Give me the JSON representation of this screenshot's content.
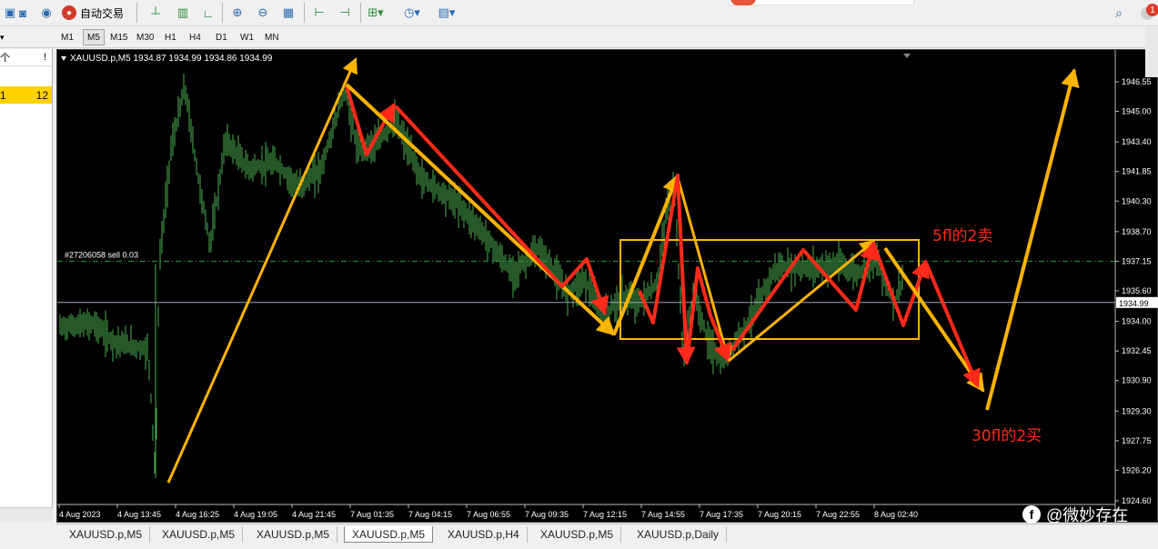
{
  "toolbar": {
    "auto_trade_label": "自动交易",
    "icons": [
      "account-icon",
      "signal-icon",
      "network-icon",
      "bar-chart-icon",
      "candle-chart-icon",
      "line-chart-icon",
      "zoom-in-icon",
      "zoom-out-icon",
      "tile-windows-icon",
      "auto-scroll-icon",
      "chart-shift-icon",
      "new-order-icon",
      "periods-icon",
      "templates-icon",
      "search-icon"
    ],
    "notification_count": "1"
  },
  "timeframes": [
    "M1",
    "M5",
    "M15",
    "M30",
    "H1",
    "H4",
    "D1",
    "W1",
    "MN"
  ],
  "active_timeframe": "M5",
  "left_panel": {
    "header_left": "个",
    "header_right": "!",
    "row_left": "1",
    "row_right": "12"
  },
  "chart": {
    "header": "XAUUSD.p,M5  1934.87 1934.99 1934.86 1934.99",
    "order_label": "#27206058 sell 0.03",
    "current_price": "1934.99",
    "annotation_sell": "5fl的2卖",
    "annotation_buy": "30fl的2买",
    "colors": {
      "background": "#000000",
      "candles": "#4caf50",
      "arrow_orange": "#ffb400",
      "arrow_red": "#ff2a1a",
      "order_line": "#2e9a3a"
    }
  },
  "chart_data": {
    "type": "candlestick",
    "symbol": "XAUUSD.p",
    "timeframe": "M5",
    "x_tick_labels": [
      "4 Aug 2023",
      "4 Aug 13:45",
      "4 Aug 16:25",
      "4 Aug 19:05",
      "4 Aug 21:45",
      "7 Aug 01:35",
      "7 Aug 04:15",
      "7 Aug 06:55",
      "7 Aug 09:35",
      "7 Aug 12:15",
      "7 Aug 14:55",
      "7 Aug 17:35",
      "7 Aug 20:15",
      "7 Aug 22:55",
      "8 Aug 02:40"
    ],
    "y_tick_labels": [
      "1946.55",
      "1945.00",
      "1943.40",
      "1941.85",
      "1940.30",
      "1938.70",
      "1937.15",
      "1935.60",
      "1934.00",
      "1932.45",
      "1930.90",
      "1929.30",
      "1927.75",
      "1926.20",
      "1924.60"
    ],
    "ylim": [
      1924.6,
      1948.0
    ],
    "order_level": 1937.15,
    "current_price_level": 1934.99,
    "last_ohlc": {
      "open": 1934.87,
      "high": 1934.99,
      "low": 1934.86,
      "close": 1934.99
    }
  },
  "tabs": [
    "XAUUSD.p,M5",
    "XAUUSD.p,M5",
    "XAUUSD.p,M5",
    "XAUUSD.p,M5",
    "XAUUSD.p,H4",
    "XAUUSD.p,M5",
    "XAUUSD.p,Daily"
  ],
  "active_tab": 3,
  "watermark": "@微妙存在"
}
